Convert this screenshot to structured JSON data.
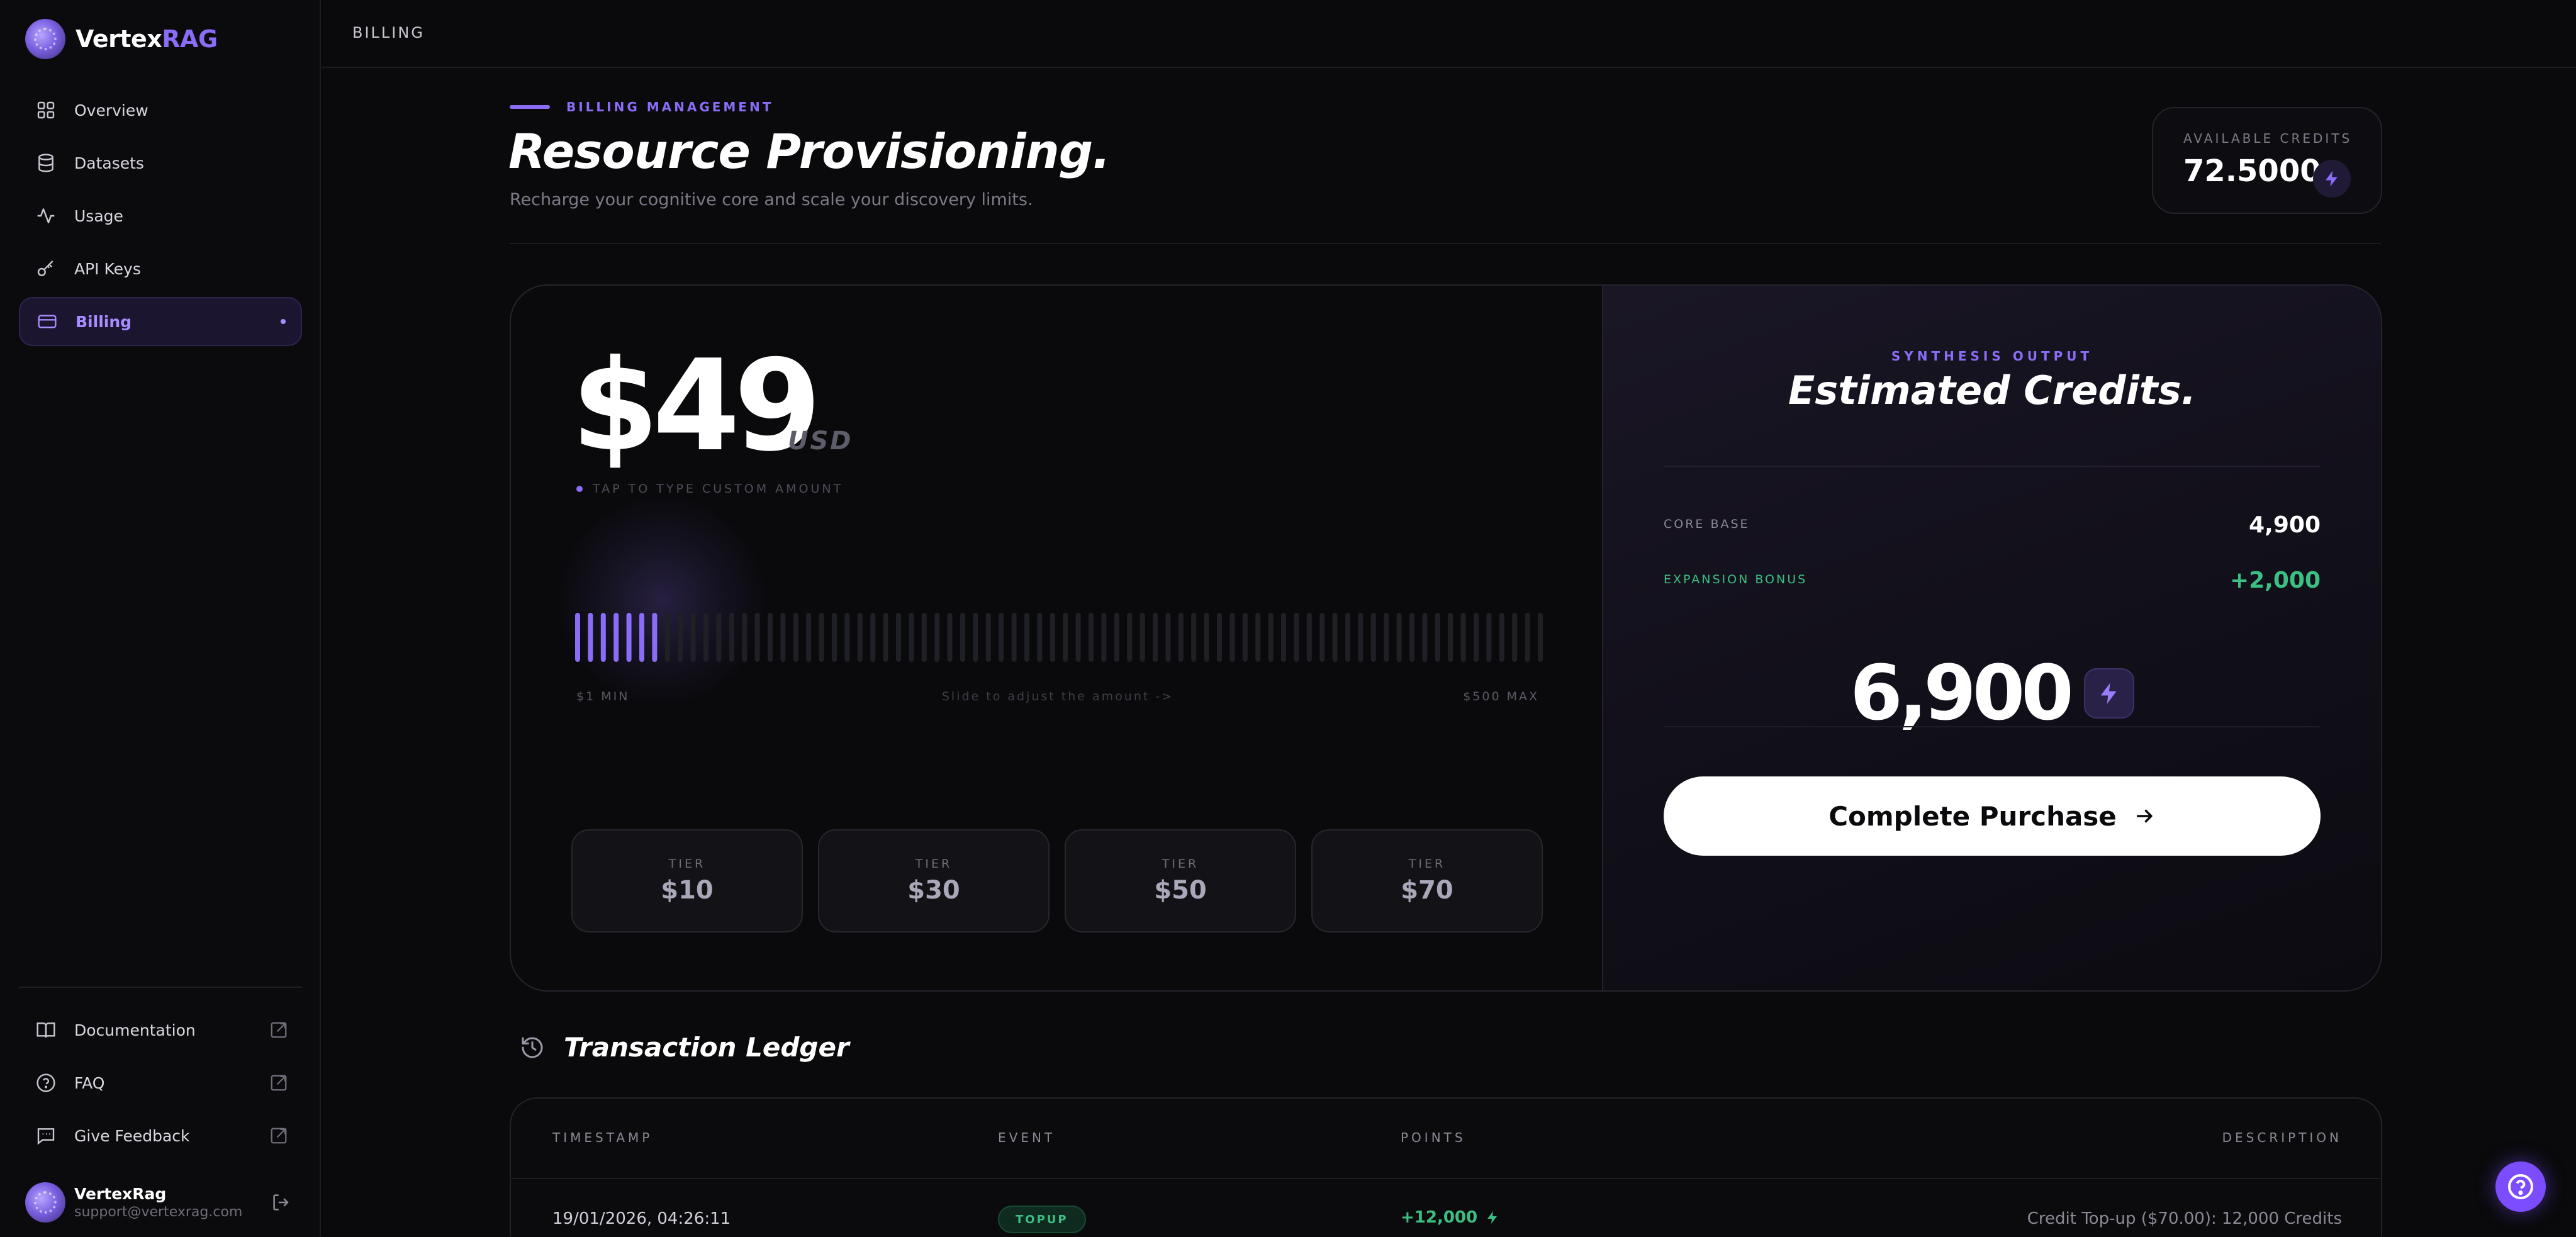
{
  "brand": {
    "name_main": "Vertex",
    "name_accent": "RAG",
    "accent_color": "#8b6cf6"
  },
  "sidebar": {
    "items": [
      {
        "label": "Overview",
        "icon": "grid-icon",
        "active": false
      },
      {
        "label": "Datasets",
        "icon": "database-icon",
        "active": false
      },
      {
        "label": "Usage",
        "icon": "activity-icon",
        "active": false
      },
      {
        "label": "API Keys",
        "icon": "key-icon",
        "active": false
      },
      {
        "label": "Billing",
        "icon": "credit-card-icon",
        "active": true
      }
    ],
    "bottom_items": [
      {
        "label": "Documentation",
        "icon": "book-icon"
      },
      {
        "label": "FAQ",
        "icon": "help-circle-icon"
      },
      {
        "label": "Give Feedback",
        "icon": "feedback-icon"
      }
    ],
    "user": {
      "name": "VertexRag",
      "email": "support@vertexrag.com"
    }
  },
  "topbar": {
    "breadcrumb": "BILLING"
  },
  "header": {
    "eyebrow": "BILLING MANAGEMENT",
    "title": "Resource Provisioning.",
    "subtitle": "Recharge your cognitive core and scale your discovery limits.",
    "available_credits_label": "AVAILABLE CREDITS",
    "available_credits_value": "72.5000"
  },
  "purchase": {
    "amount": "$49",
    "currency": "USD",
    "tap_hint": "TAP TO TYPE CUSTOM AMOUNT",
    "slider": {
      "min_label": "$1 MIN",
      "hint": "Slide to adjust the amount ->",
      "max_label": "$500 MAX",
      "min": 1,
      "max": 500,
      "value": 49
    },
    "tiers": [
      {
        "label": "TIER",
        "value": "$10"
      },
      {
        "label": "TIER",
        "value": "$30"
      },
      {
        "label": "TIER",
        "value": "$50"
      },
      {
        "label": "TIER",
        "value": "$70"
      }
    ]
  },
  "estimate": {
    "eyebrow": "SYNTHESIS OUTPUT",
    "title": "Estimated Credits.",
    "core_base_label": "CORE BASE",
    "core_base_value": "4,900",
    "bonus_label": "EXPANSION BONUS",
    "bonus_value": "+2,000",
    "total": "6,900",
    "cta": "Complete Purchase"
  },
  "ledger": {
    "title": "Transaction Ledger",
    "columns": [
      "TIMESTAMP",
      "EVENT",
      "POINTS",
      "DESCRIPTION"
    ],
    "rows": [
      {
        "timestamp": "19/01/2026, 04:26:11",
        "event": "TOPUP",
        "points": "+12,000",
        "description": "Credit Top-up ($70.00): 12,000 Credits"
      }
    ]
  },
  "colors": {
    "success": "#3cbf82",
    "accent": "#8b6cf6",
    "background": "#0a0a0c"
  }
}
